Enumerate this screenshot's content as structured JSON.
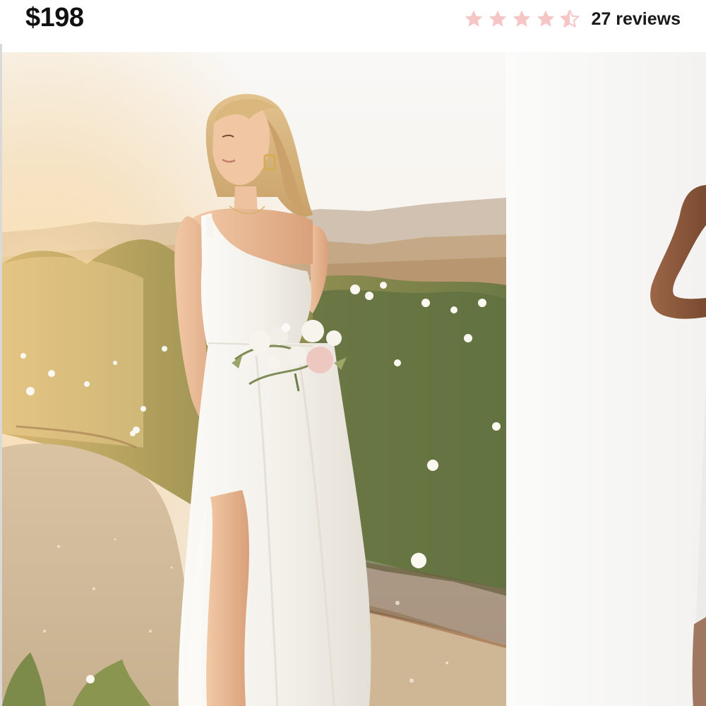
{
  "product": {
    "price": "$198",
    "rating": {
      "value": 4.5,
      "max": 5,
      "reviews_label": "27 reviews",
      "star_color": "#f6c6c6"
    }
  },
  "gallery": {
    "images": [
      {
        "name": "model-in-garden-photo",
        "icon": "photo"
      },
      {
        "name": "model-studio-photo",
        "icon": "photo"
      }
    ]
  }
}
